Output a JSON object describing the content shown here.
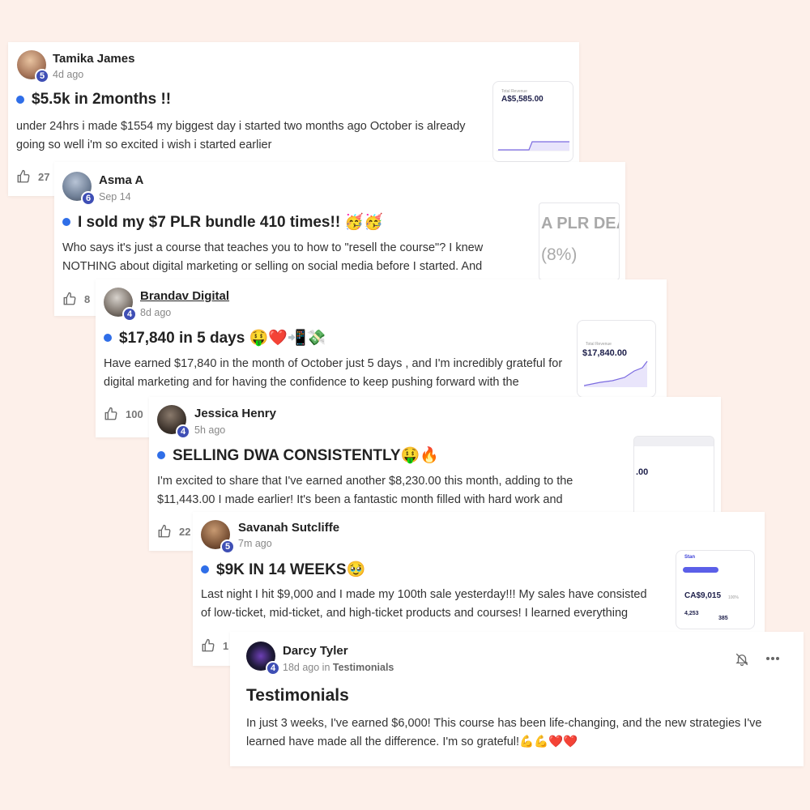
{
  "posts": [
    {
      "author": "Tamika James",
      "level": "5",
      "time": "4d ago",
      "title": "$5.5k in 2months !!",
      "body": "under 24hrs i made $1554 my biggest day i started two months ago October is already going so well i'm so excited i wish i started earlier",
      "likes": "27",
      "thumb": {
        "label": "Total Revenue",
        "value": "A$5,585.00"
      }
    },
    {
      "author": "Asma A",
      "level": "6",
      "time": "Sep 14",
      "title": "I sold my $7 PLR bundle 410 times!! 🥳🥳",
      "body": "Who says it's just a course that teaches you to how to \"resell the course\"? I knew NOTHING about digital marketing or selling on social media before I started. And",
      "likes": "8",
      "thumb": {
        "line1": "A PLR DEA",
        "line2": "(8%)"
      }
    },
    {
      "author": "Brandav Digital",
      "level": "4",
      "time": "8d ago",
      "title": "$17,840 in 5 days 🤑❤️📲💸",
      "body": "Have earned $17,840 in the month of October just 5 days , and I'm incredibly grateful for digital marketing and for having the confidence to keep pushing forward with the",
      "likes": "100",
      "thumb": {
        "label": "Total Revenue",
        "value": "$17,840.00"
      }
    },
    {
      "author": "Jessica Henry",
      "level": "4",
      "time": "5h ago",
      "title": "SELLING DWA CONSISTENTLY🤑🔥",
      "body": "I'm excited to share that I've earned another $8,230.00 this month, adding to the $11,443.00 I made earlier! It's been a fantastic month filled with hard work and",
      "likes": "22",
      "thumb": {
        "value": ".00"
      }
    },
    {
      "author": "Savanah Sutcliffe",
      "level": "5",
      "time": "7m ago",
      "title": "$9K IN 14 WEEKS🥹",
      "body": "Last night I hit $9,000 and I made my 100th sale yesterday!!! My sales have consisted of low-ticket, mid-ticket, and high-ticket products and courses! I learned everything",
      "likes": "1",
      "thumb": {
        "brand": "Stan",
        "value": "CA$9,015",
        "pct": "100%",
        "stat1": "4,253",
        "stat2": "385"
      }
    },
    {
      "author": "Darcy Tyler",
      "level": "4",
      "time": "18d ago",
      "in_word": "in",
      "category": "Testimonials",
      "title": "Testimonials",
      "body": "In just 3 weeks, I've earned $6,000! This course has been life-changing, and the new strategies I've learned have made all the difference. I'm so grateful!💪💪❤️❤️"
    }
  ],
  "colors": {
    "background": "#fdf0ea",
    "accent_dot": "#2f6ee8",
    "badge": "#3f4fb5"
  },
  "icons": [
    "thumbs-up-icon",
    "bell-icon",
    "more-icon"
  ]
}
